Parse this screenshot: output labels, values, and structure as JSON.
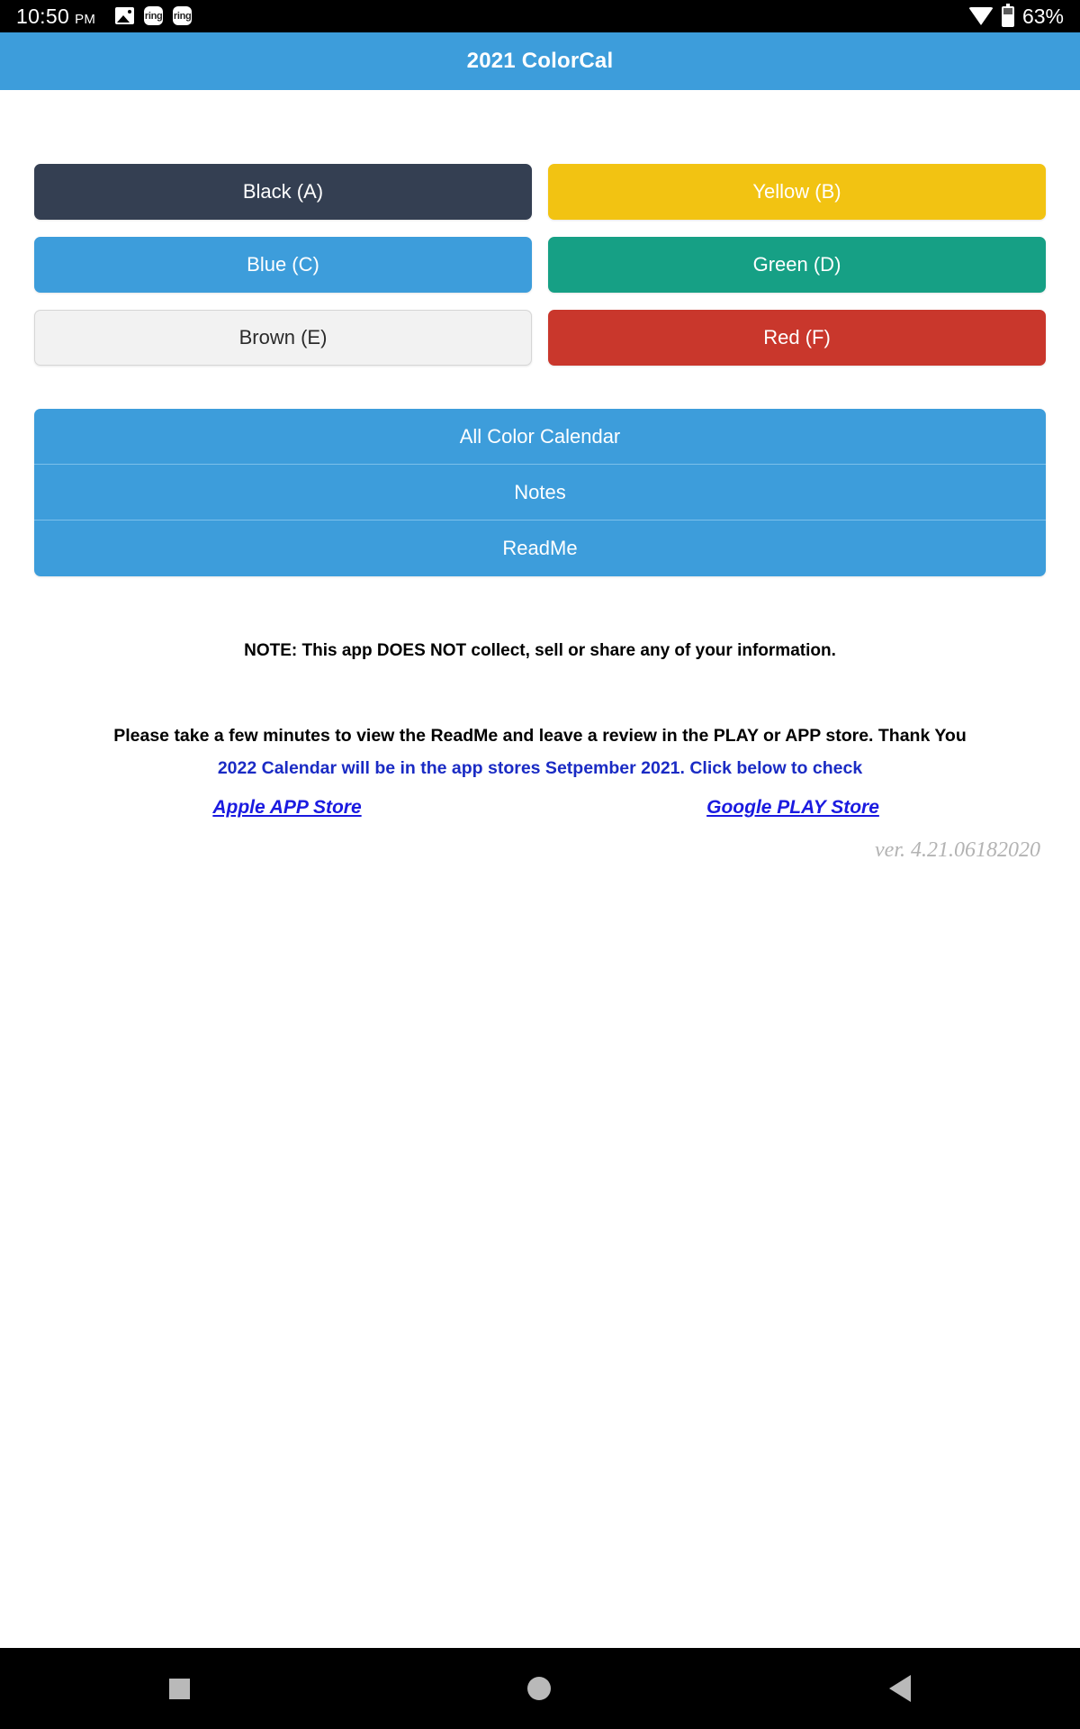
{
  "status_bar": {
    "time": "10:50",
    "am_pm": "PM",
    "left_icons": [
      "image-icon",
      "ring-icon",
      "ring-icon"
    ],
    "ring_label": "ring",
    "wifi_icon": "wifi-icon",
    "battery_icon": "battery-icon",
    "battery_percent": "63%"
  },
  "app_bar": {
    "title": "2021 ColorCal",
    "background": "#3d9ddb"
  },
  "color_buttons": [
    {
      "label": "Black (A)",
      "bg": "#343f52",
      "fg": "#ffffff"
    },
    {
      "label": "Yellow (B)",
      "bg": "#f2c312",
      "fg": "#ffffff"
    },
    {
      "label": "Blue (C)",
      "bg": "#3d9ddb",
      "fg": "#ffffff"
    },
    {
      "label": "Green (D)",
      "bg": "#16a085",
      "fg": "#ffffff"
    },
    {
      "label": "Brown (E)",
      "bg": "#f2f2f2",
      "fg": "#2b2b2b"
    },
    {
      "label": "Red (F)",
      "bg": "#c9372c",
      "fg": "#ffffff"
    }
  ],
  "menu_list": [
    {
      "label": "All Color Calendar"
    },
    {
      "label": "Notes"
    },
    {
      "label": "ReadMe"
    }
  ],
  "note": "NOTE: This app DOES NOT collect, sell or share any of your information.",
  "promo": {
    "line1": "Please take a few minutes to view the ReadMe and leave a review in the PLAY or APP store. Thank You",
    "line2": "2022 Calendar will be in the app stores Setpember 2021. Click below to check",
    "line2_color": "#1a2bc4"
  },
  "store_links": [
    {
      "label": "Apple APP Store"
    },
    {
      "label": "Google PLAY Store"
    }
  ],
  "version": "ver. 4.21.06182020",
  "nav_bar": {
    "items": [
      "square-icon",
      "circle-icon",
      "back-triangle-icon"
    ]
  }
}
